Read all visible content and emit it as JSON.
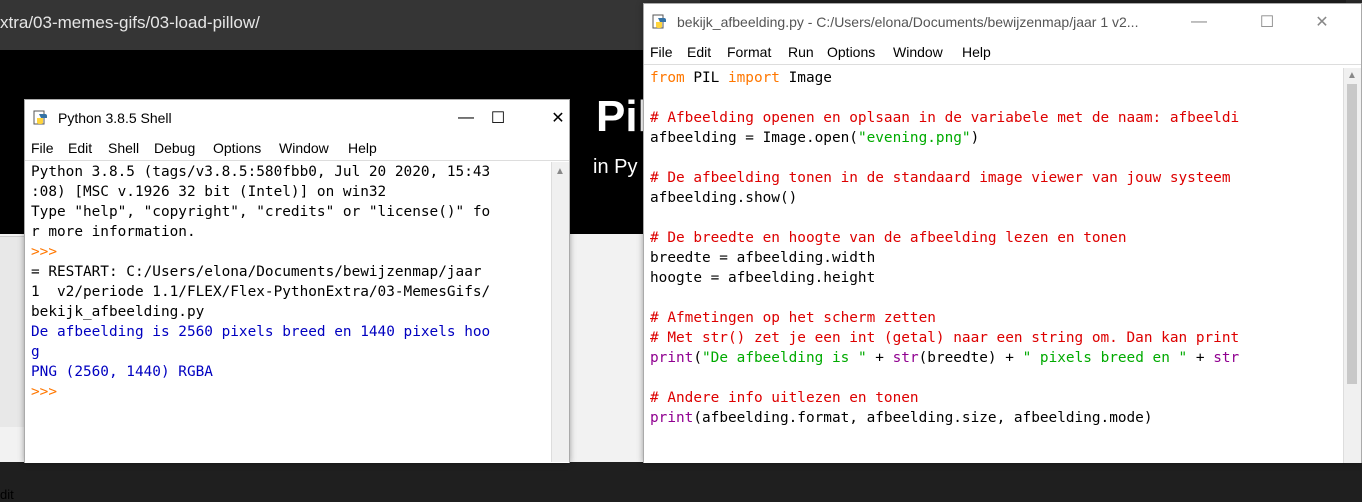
{
  "browser": {
    "url": "xtra/03-memes-gifs/03-load-pillow/",
    "heading": "Pillo",
    "subheading": "in Py",
    "edit_label": "dit"
  },
  "shell": {
    "title": "Python 3.8.5 Shell",
    "menu": [
      "File",
      "Edit",
      "Shell",
      "Debug",
      "Options",
      "Window",
      "Help"
    ],
    "lines": [
      {
        "t": "Python 3.8.5 (tags/v3.8.5:580fbb0, Jul 20 2020, 15:43",
        "c": "err"
      },
      {
        "t": ":08) [MSC v.1926 32 bit (Intel)] on win32",
        "c": "err"
      },
      {
        "t": "Type \"help\", \"copyright\", \"credits\" or \"license()\" fo",
        "c": "err"
      },
      {
        "t": "r more information.",
        "c": "err"
      },
      {
        "t": ">>> ",
        "c": "kw"
      },
      {
        "t": "= RESTART: C:/Users/elona/Documents/bewijzenmap/jaar",
        "c": "err"
      },
      {
        "t": "1  v2/periode 1.1/FLEX/Flex-PythonExtra/03-MemesGifs/",
        "c": "err"
      },
      {
        "t": "bekijk_afbeelding.py",
        "c": "err"
      },
      {
        "t": "De afbeelding is 2560 pixels breed en 1440 pixels hoo",
        "c": "out"
      },
      {
        "t": "g",
        "c": "out"
      },
      {
        "t": "PNG (2560, 1440) RGBA",
        "c": "out"
      },
      {
        "t": ">>> ",
        "c": "kw"
      }
    ]
  },
  "editor": {
    "title": "bekijk_afbeelding.py - C:/Users/elona/Documents/bewijzenmap/jaar 1  v2...",
    "menu": [
      "File",
      "Edit",
      "Format",
      "Run",
      "Options",
      "Window",
      "Help"
    ],
    "lines": [
      [
        {
          "t": "from",
          "c": "kw"
        },
        {
          "t": " PIL "
        },
        {
          "t": "import",
          "c": "kw"
        },
        {
          "t": " Image"
        }
      ],
      [],
      [
        {
          "t": "# Afbeelding openen en oplsaan in de variabele met de naam: afbeeldi",
          "c": "cm"
        }
      ],
      [
        {
          "t": "afbeelding = Image.open("
        },
        {
          "t": "\"evening.png\"",
          "c": "str"
        },
        {
          "t": ")"
        }
      ],
      [],
      [
        {
          "t": "# De afbeelding tonen in de standaard image viewer van jouw systeem",
          "c": "cm"
        }
      ],
      [
        {
          "t": "afbeelding.show()"
        }
      ],
      [],
      [
        {
          "t": "# De breedte en hoogte van de afbeelding lezen en tonen",
          "c": "cm"
        }
      ],
      [
        {
          "t": "breedte = afbeelding.width"
        }
      ],
      [
        {
          "t": "hoogte = afbeelding.height"
        }
      ],
      [],
      [
        {
          "t": "# Afmetingen op het scherm zetten",
          "c": "cm"
        }
      ],
      [
        {
          "t": "# Met str() zet je een int (getal) naar een string om. Dan kan print",
          "c": "cm"
        }
      ],
      [
        {
          "t": "print",
          "c": "bi"
        },
        {
          "t": "("
        },
        {
          "t": "\"De afbeelding is \"",
          "c": "str"
        },
        {
          "t": " + "
        },
        {
          "t": "str",
          "c": "bi"
        },
        {
          "t": "(breedte) + "
        },
        {
          "t": "\" pixels breed en \"",
          "c": "str"
        },
        {
          "t": " + "
        },
        {
          "t": "str",
          "c": "bi"
        }
      ],
      [],
      [
        {
          "t": "# Andere info uitlezen en tonen",
          "c": "cm"
        }
      ],
      [
        {
          "t": "print",
          "c": "bi"
        },
        {
          "t": "(afbeelding.format, afbeelding.size, afbeelding.mode)"
        }
      ]
    ]
  }
}
